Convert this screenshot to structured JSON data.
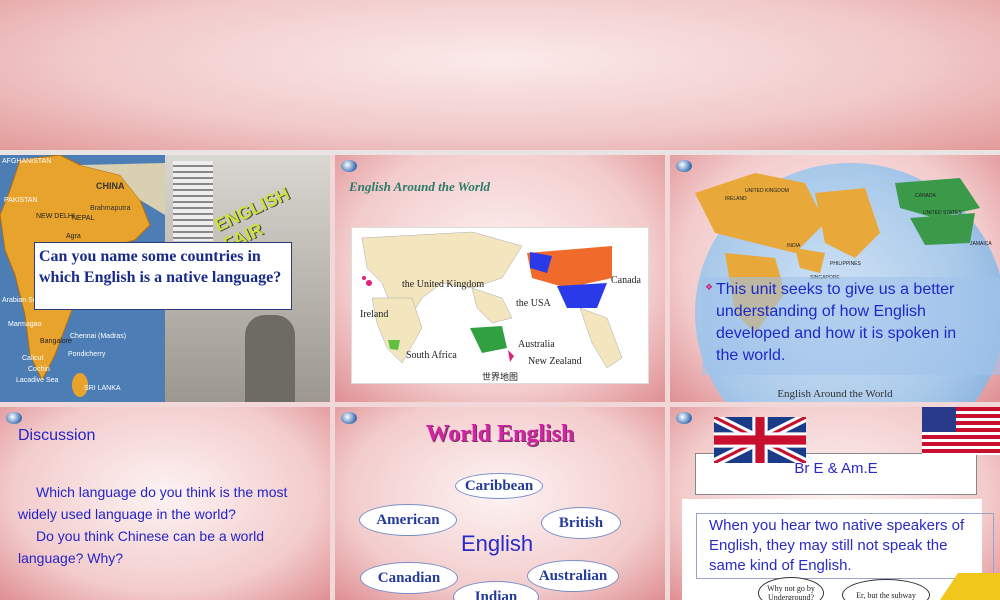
{
  "slide1": {
    "question": "Can you name some countries in which English is a native language?",
    "map_labels": [
      "AFGHANISTAN",
      "PAKISTAN",
      "CHINA",
      "NEW DELHI",
      "NEPAL",
      "Agra",
      "Brahmaputra",
      "Arabian Sea",
      "Bangalore",
      "Chennai (Madras)",
      "Pondicherry",
      "Calicut",
      "Cochin",
      "Lacadive Sea",
      "SRI LANKA",
      "Marmagao"
    ],
    "poster_text": "ENGLISH FAIR"
  },
  "slide2": {
    "title": "English Around the World",
    "labels": {
      "uk": "the United Kingdom",
      "ireland": "Ireland",
      "usa": "the USA",
      "canada": "Canada",
      "australia": "Australia",
      "south_africa": "South Africa",
      "new_zealand": "New Zealand",
      "caption": "世界地图"
    }
  },
  "slide3": {
    "bullet": "This unit seeks to give us a better understanding of how English developed and how it is spoken in the world.",
    "footer": "English Around the World",
    "map_labels": [
      "UNITED KINGDOM",
      "IRELAND",
      "CANADA",
      "UNITED STATES",
      "JAMAICA",
      "INDIA",
      "PHILIPPINES",
      "SINGAPORE"
    ]
  },
  "slide4": {
    "title": "Discussion",
    "q1": "Which language do you think is the most widely used language in the world?",
    "q2": "Do you think Chinese can be a world language? Why?"
  },
  "slide5": {
    "title": "World English",
    "center": "English",
    "ovals": [
      "Caribbean",
      "American",
      "British",
      "Canadian",
      "Australian",
      "Indian"
    ]
  },
  "slide6": {
    "heading": "Br E & Am.E",
    "text": "When you hear two native speakers of English, they may still not speak the same kind of English.",
    "bubble1": "Why not go by Underground?",
    "bubble2": "Er, but the subway"
  },
  "colors": {
    "title_blue": "#2a2ac8",
    "magenta": "#d623a6",
    "teal": "#2a7a6a"
  }
}
